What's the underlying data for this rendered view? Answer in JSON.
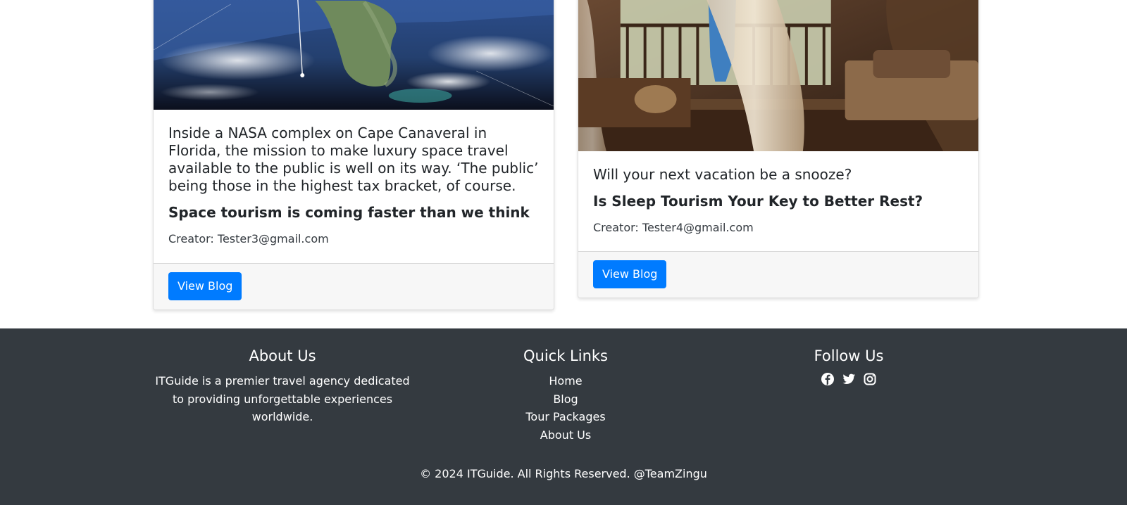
{
  "cards": [
    {
      "image_alt": "satellite view of Florida",
      "text": "Inside a NASA complex on Cape Canaveral in Florida, the mission to make luxury space travel available to the public is well on its way. ‘The public’ being those in the highest tax bracket, of course.",
      "title": "Space tourism is coming faster than we think",
      "creator": "Creator: Tester3@gmail.com",
      "button_label": "View Blog"
    },
    {
      "image_alt": "canopy bed in tropical resort room",
      "text": "Will your next vacation be a snooze?",
      "title": "Is Sleep Tourism Your Key to Better Rest?",
      "creator": "Creator: Tester4@gmail.com",
      "button_label": "View Blog"
    }
  ],
  "footer": {
    "about": {
      "heading": "About Us",
      "text": "ITGuide is a premier travel agency dedicated to providing unforgettable experiences worldwide."
    },
    "quick_links": {
      "heading": "Quick Links",
      "items": [
        "Home",
        "Blog",
        "Tour Packages",
        "About Us"
      ]
    },
    "follow": {
      "heading": "Follow Us",
      "icons": [
        "facebook-icon",
        "twitter-icon",
        "instagram-icon"
      ]
    },
    "copyright": "© 2024 ITGuide. All Rights Reserved. @TeamZingu"
  },
  "colors": {
    "primary_button": "#007bff",
    "footer_bg": "#343a40",
    "card_footer_bg": "#f7f7f7"
  }
}
